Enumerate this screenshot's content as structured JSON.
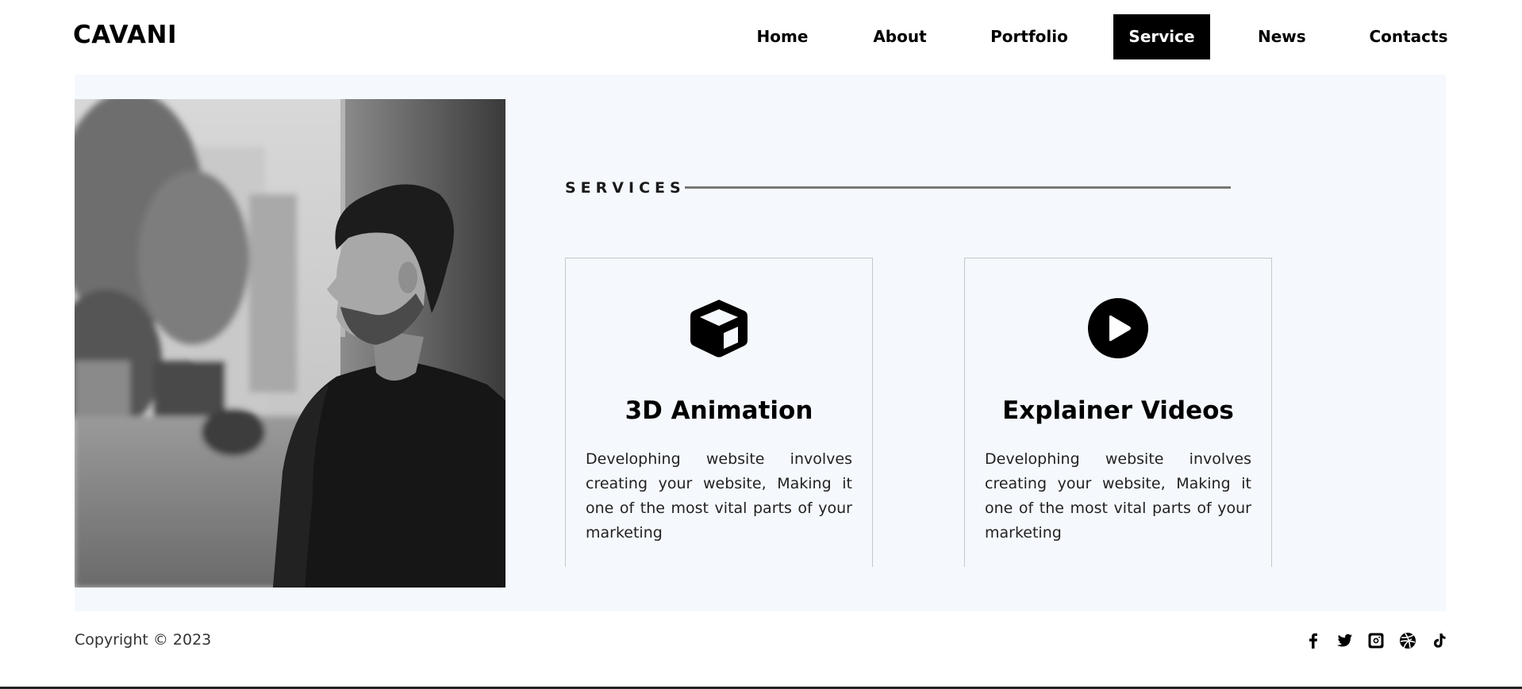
{
  "brand": {
    "logo": "CAVANI"
  },
  "nav": {
    "items": [
      {
        "label": "Home"
      },
      {
        "label": "About"
      },
      {
        "label": "Portfolio"
      },
      {
        "label": "Service",
        "active": true
      },
      {
        "label": "News"
      },
      {
        "label": "Contacts"
      }
    ]
  },
  "services": {
    "heading": "SERVICES",
    "cards": [
      {
        "icon": "cube-icon",
        "title": "3D Animation",
        "text": "Develophing website involves creating your website, Making it one of the most vital parts of your marketing"
      },
      {
        "icon": "play-circle-icon",
        "title": "Explainer Videos",
        "text": "Develophing website involves creating your website, Making it one of the most vital parts of your marketing"
      }
    ]
  },
  "footer": {
    "copyright": "Copyright © 2023",
    "social": [
      {
        "icon": "facebook-icon"
      },
      {
        "icon": "twitter-icon"
      },
      {
        "icon": "instagram-icon"
      },
      {
        "icon": "dribbble-icon"
      },
      {
        "icon": "tiktok-icon"
      }
    ]
  },
  "colors": {
    "panel_background": "#f5f9fd",
    "active_nav_background": "#000000",
    "active_nav_text": "#ffffff",
    "card_border": "#c6c8ca"
  }
}
